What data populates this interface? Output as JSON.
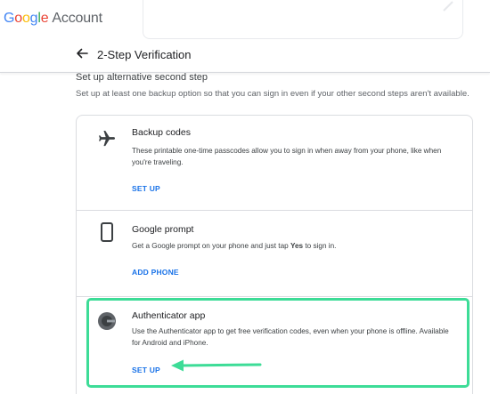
{
  "header": {
    "logo_brand": "Google",
    "logo_product": "Account",
    "logo_colors": [
      "#4285F4",
      "#EA4335",
      "#FBBC05",
      "#4285F4",
      "#34A853",
      "#EA4335"
    ],
    "page_title": "2-Step Verification",
    "back_icon": "arrow-back-icon"
  },
  "section": {
    "title": "Set up alternative second step",
    "description": "Set up at least one backup option so that you can sign in even if your other second steps aren't available."
  },
  "options": [
    {
      "icon": "airplane-icon",
      "title": "Backup codes",
      "description": "These printable one-time passcodes allow you to sign in when away from your phone, like when you're traveling.",
      "action": "SET UP"
    },
    {
      "icon": "phone-icon",
      "title": "Google prompt",
      "description_prefix": "Get a Google prompt on your phone and just tap ",
      "description_bold": "Yes",
      "description_suffix": " to sign in.",
      "action": "ADD PHONE"
    },
    {
      "icon": "authenticator-icon",
      "title": "Authenticator app",
      "description": "Use the Authenticator app to get free verification codes, even when your phone is offline. Available for Android and iPhone.",
      "action": "SET UP"
    }
  ],
  "colors": {
    "accent": "#1a73e8",
    "highlight": "#3ddc97",
    "divider": "#dadce0"
  }
}
